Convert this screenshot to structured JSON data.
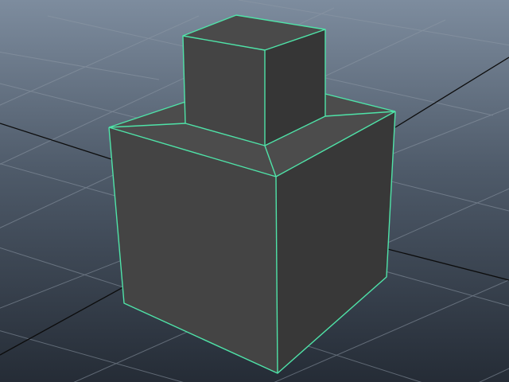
{
  "viewport": {
    "background_top": "#7d8c9e",
    "background_bottom": "#252c36",
    "grid_color": "#8e99a6",
    "axis_color": "#0c0c0c"
  },
  "mesh": {
    "face_left": "#444444",
    "face_right": "#383838",
    "face_top": "#4c4c4c",
    "wire_color": "#4fe3a8",
    "selected": true
  }
}
